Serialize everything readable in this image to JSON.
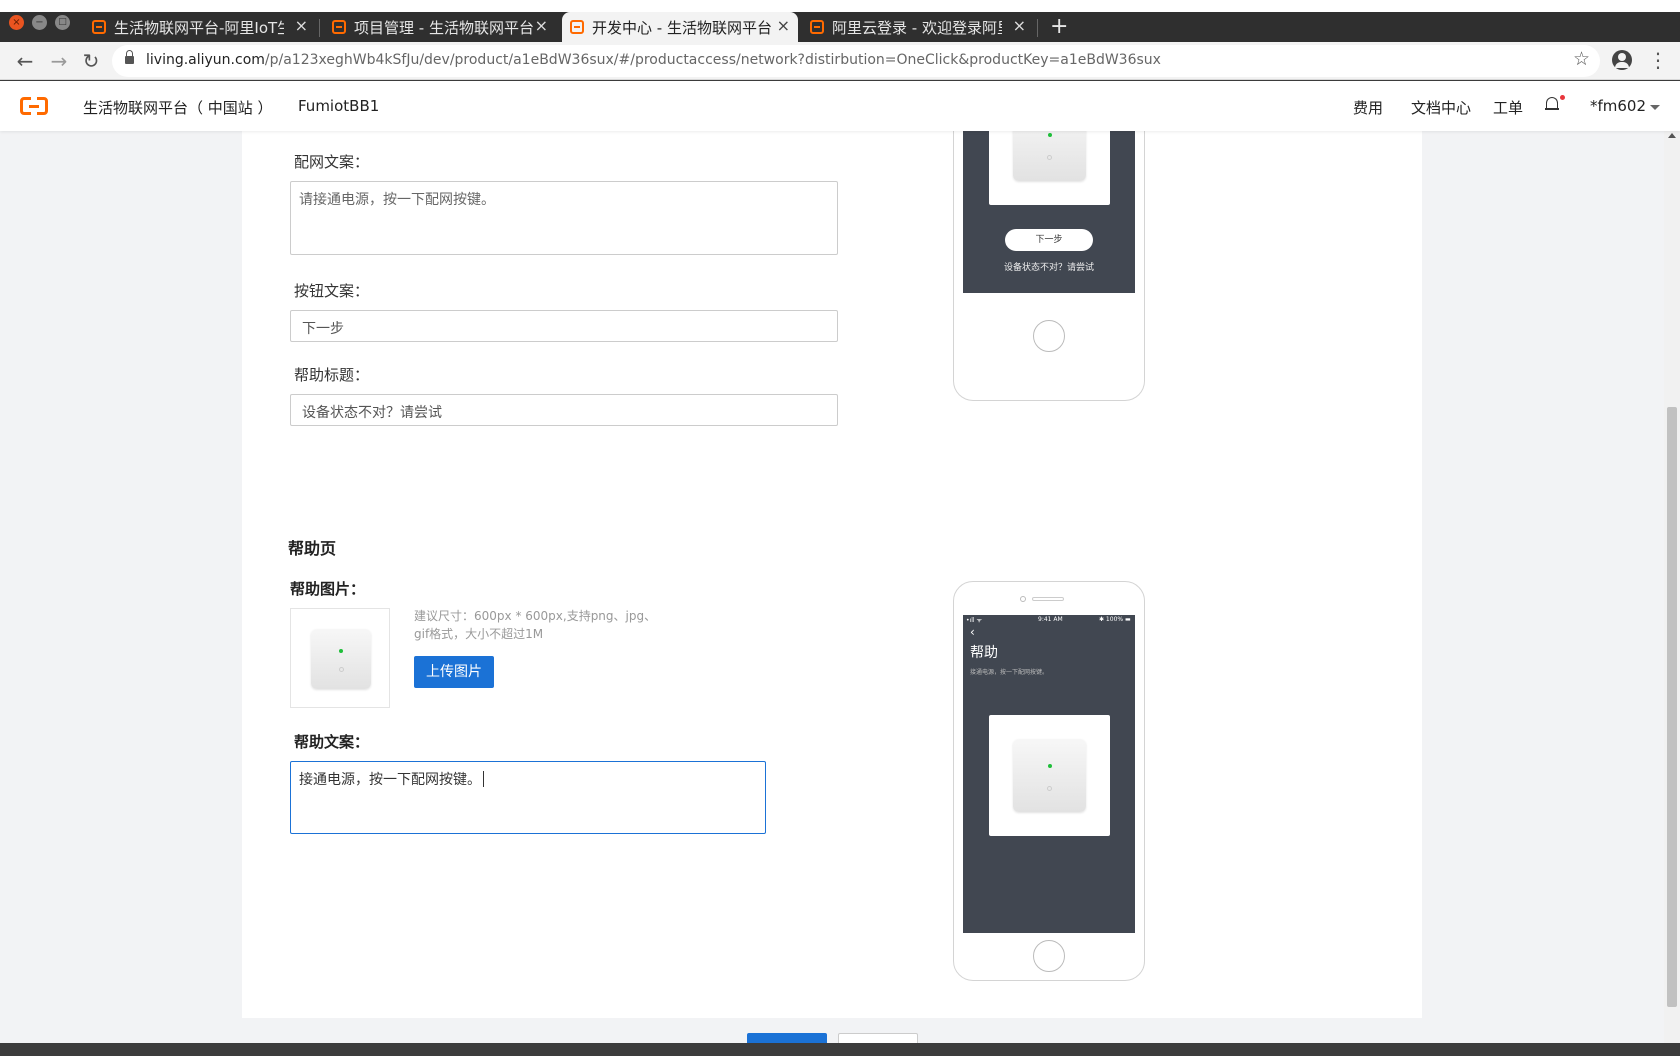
{
  "browser": {
    "tabs": [
      {
        "title": "生活物联网平台-阿里IoT生"
      },
      {
        "title": "项目管理 - 生活物联网平台"
      },
      {
        "title": "开发中心 - 生活物联网平台"
      },
      {
        "title": "阿里云登录 - 欢迎登录阿里"
      }
    ],
    "new_tab_glyph": "+",
    "url_host": "living.aliyun.com",
    "url_path": "/p/a123xeghWb4kSfJu/dev/product/a1eBdW36sux/#/productaccess/network?distirbution=OneClick&productKey=a1eBdW36sux"
  },
  "header": {
    "site_name": "生活物联网平台（ 中国站 ）",
    "project_name": "FumiotBB1",
    "links": {
      "fees": "费用",
      "docs": "文档中心",
      "tickets": "工单"
    },
    "user": "*fm602"
  },
  "form": {
    "network_copy_label": "配网文案：",
    "network_copy_placeholder": "请接通电源，按一下配网按键。",
    "button_copy_label": "按钮文案：",
    "button_copy_placeholder": "下一步",
    "help_title_label": "帮助标题：",
    "help_title_placeholder": "设备状态不对？请尝试"
  },
  "help_page": {
    "section_title": "帮助页",
    "image_label": "帮助图片：",
    "image_hint_line1": "建议尺寸：600px * 600px,支持png、jpg、",
    "image_hint_line2": "gif格式，大小不超过1M",
    "upload_label": "上传图片",
    "help_copy_label": "帮助文案：",
    "help_copy_value": "接通电源，按一下配网按键。"
  },
  "preview_top": {
    "next_button": "下一步",
    "help_link": "设备状态不对？请尝试"
  },
  "preview_help": {
    "status_left": "•ıll ᯤ",
    "status_time": "9:41 AM",
    "status_right": "✱ 100% ▬",
    "back_glyph": "‹",
    "title": "帮助",
    "subtitle": "接通电源，按一下配网按键。"
  },
  "icons": {
    "back": "←",
    "forward": "→",
    "reload": "↻",
    "star": "☆",
    "menu": "⋮",
    "close_tab": "×"
  },
  "colors": {
    "brand": "#ff6a00",
    "primary": "#1b72d6",
    "preview_bg": "#414751",
    "led": "#1fbe3a"
  }
}
